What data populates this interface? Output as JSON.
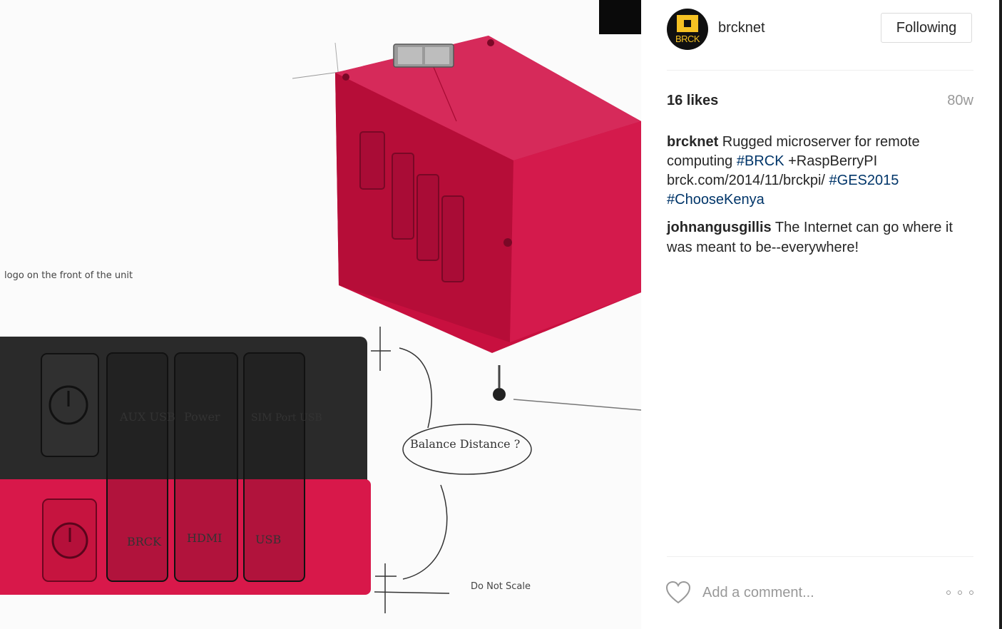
{
  "post": {
    "username": "brcknet",
    "avatar_text": "BRCK",
    "follow_label": "Following",
    "likes": "16 likes",
    "age": "80w"
  },
  "caption": {
    "user": "brcknet",
    "text_1": " Rugged microserver for remote computing ",
    "tag_1": "#BRCK",
    "text_2": " +RaspBerryPI brck.com/2014/11/brckpi/ ",
    "tag_2": "#GES2015",
    "text_3": " ",
    "tag_3": "#ChooseKenya"
  },
  "comments": [
    {
      "user": "johnangusgillis",
      "text": " The Internet can go where it was meant to be--everywhere!"
    }
  ],
  "composer": {
    "placeholder": "Add a comment..."
  },
  "sketch": {
    "note_logo": "logo on the front of the unit",
    "note_scale": "Do Not Scale",
    "btn_1": "AUX USB",
    "btn_2": "Power",
    "btn_3": "SIM Port USB",
    "btn_4": "BRCK",
    "btn_5": "HDMI",
    "btn_6": "USB",
    "callout": "Balance Distance ?"
  },
  "icons": {
    "like": "heart-icon",
    "more": "more-options-icon",
    "avatar": "brck-logo"
  },
  "colors": {
    "accent_red": "#d8184a",
    "hashtag": "#003569",
    "brand_yellow": "#f6c223"
  }
}
